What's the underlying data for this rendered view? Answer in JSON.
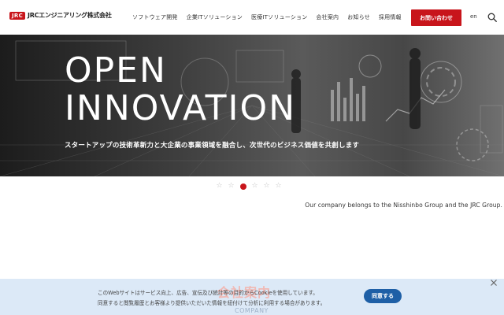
{
  "header": {
    "logo_mark": "JRC",
    "logo_text": "JRCエンジニアリング株式会社",
    "nav": [
      {
        "label": "ソフトウェア開発"
      },
      {
        "label": "企業ITソリューション"
      },
      {
        "label": "医療ITソリューション"
      },
      {
        "label": "会社案内"
      },
      {
        "label": "お知らせ"
      },
      {
        "label": "採用情報"
      }
    ],
    "contact_label": "お問い合わせ",
    "lang_label": "en",
    "search_icon": "search-icon"
  },
  "hero": {
    "title_line1": "OPEN",
    "title_line2": "INNOVATION",
    "subtitle": "スタートアップの技術革新力と大企業の事業領域を融合し、次世代のビジネス価値を共創します"
  },
  "slider": {
    "count": 6,
    "active_index": 3
  },
  "group_note": "Our company belongs to the Nisshinbo Group and the JRC Group.",
  "cookie": {
    "line1": "このWebサイトはサービス向上、広告、宣伝及び統計等の目的からCookieを使用しています。",
    "line2": "同意すると閲覧履歴とお客様より提供いただいた情報を紐付けて分析に利用する場合があります。",
    "agree_label": "同意する",
    "bg_title": "会社案内",
    "bg_sub": "COMPANY"
  },
  "colors": {
    "brand_red": "#c8151b",
    "agree_blue": "#1e5fa6",
    "banner_bg": "#dce9f7"
  }
}
